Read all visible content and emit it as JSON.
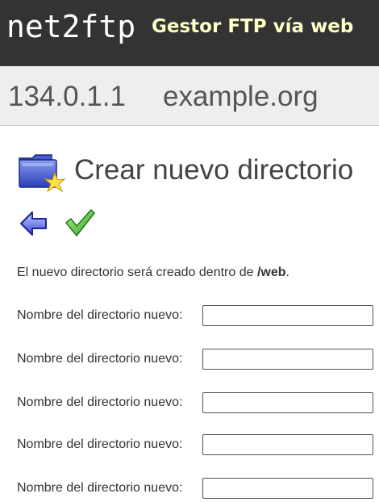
{
  "header": {
    "logo": "net2ftp",
    "tagline": "Gestor FTP vía web"
  },
  "host": {
    "ip": "134.0.1.1",
    "name": "example.org"
  },
  "page": {
    "title": "Crear nuevo directorio",
    "title_icon": "new-folder-icon"
  },
  "toolbar": {
    "back_icon": "back-arrow-icon",
    "submit_icon": "checkmark-icon"
  },
  "intro": {
    "prefix": "El nuevo directorio será creado dentro de ",
    "path": "/web",
    "suffix": "."
  },
  "fields": [
    {
      "label": "Nombre del directorio nuevo:",
      "value": ""
    },
    {
      "label": "Nombre del directorio nuevo:",
      "value": ""
    },
    {
      "label": "Nombre del directorio nuevo:",
      "value": ""
    },
    {
      "label": "Nombre del directorio nuevo:",
      "value": ""
    },
    {
      "label": "Nombre del directorio nuevo:",
      "value": ""
    }
  ],
  "colors": {
    "topbar": "#333333",
    "tagline": "#ffffc8",
    "hostbar": "#eeeeee"
  }
}
